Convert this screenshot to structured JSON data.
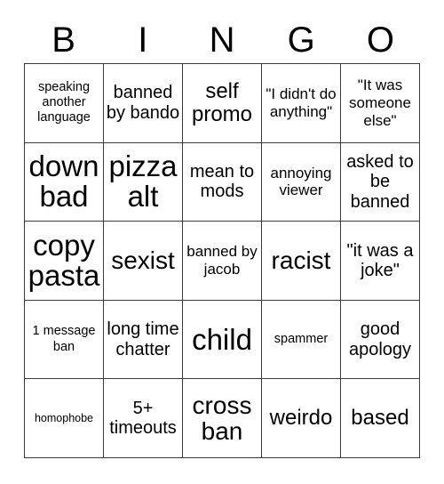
{
  "card": {
    "title": "BINGO",
    "header_letters": [
      "B",
      "I",
      "N",
      "G",
      "O"
    ],
    "columns": 5,
    "rows": 5,
    "border_color": "#3a3a3a",
    "background_color": "#ffffff",
    "text_color": "#000000",
    "cells": [
      {
        "text": "speaking another language",
        "size": "xs",
        "marked": false
      },
      {
        "text": "banned by bando",
        "size": "m",
        "marked": false
      },
      {
        "text": "self promo",
        "size": "l",
        "marked": false
      },
      {
        "text": "\"I didn't do anything\"",
        "size": "s",
        "marked": false
      },
      {
        "text": "\"It was someone else\"",
        "size": "s",
        "marked": false
      },
      {
        "text": "down bad",
        "size": "xxl",
        "marked": false
      },
      {
        "text": "pizza alt",
        "size": "xxl",
        "marked": false
      },
      {
        "text": "mean to mods",
        "size": "m",
        "marked": false
      },
      {
        "text": "annoying viewer",
        "size": "s",
        "marked": false
      },
      {
        "text": "asked to be banned",
        "size": "m",
        "marked": false
      },
      {
        "text": "copy pasta",
        "size": "xxl",
        "marked": false
      },
      {
        "text": "sexist",
        "size": "xl",
        "marked": false
      },
      {
        "text": "banned by jacob",
        "size": "s",
        "marked": false
      },
      {
        "text": "racist",
        "size": "xl",
        "marked": false
      },
      {
        "text": "\"it was a joke\"",
        "size": "m",
        "marked": false
      },
      {
        "text": "1 message ban",
        "size": "xs",
        "marked": false
      },
      {
        "text": "long time chatter",
        "size": "m",
        "marked": false
      },
      {
        "text": "child",
        "size": "xxl",
        "marked": false
      },
      {
        "text": "spammer",
        "size": "xs",
        "marked": false
      },
      {
        "text": "good apology",
        "size": "m",
        "marked": false
      },
      {
        "text": "homophobe",
        "size": "xxs",
        "marked": false
      },
      {
        "text": "5+ timeouts",
        "size": "m",
        "marked": false
      },
      {
        "text": "cross ban",
        "size": "xl",
        "marked": false
      },
      {
        "text": "weirdo",
        "size": "l",
        "marked": false
      },
      {
        "text": "based",
        "size": "l",
        "marked": false
      }
    ]
  }
}
